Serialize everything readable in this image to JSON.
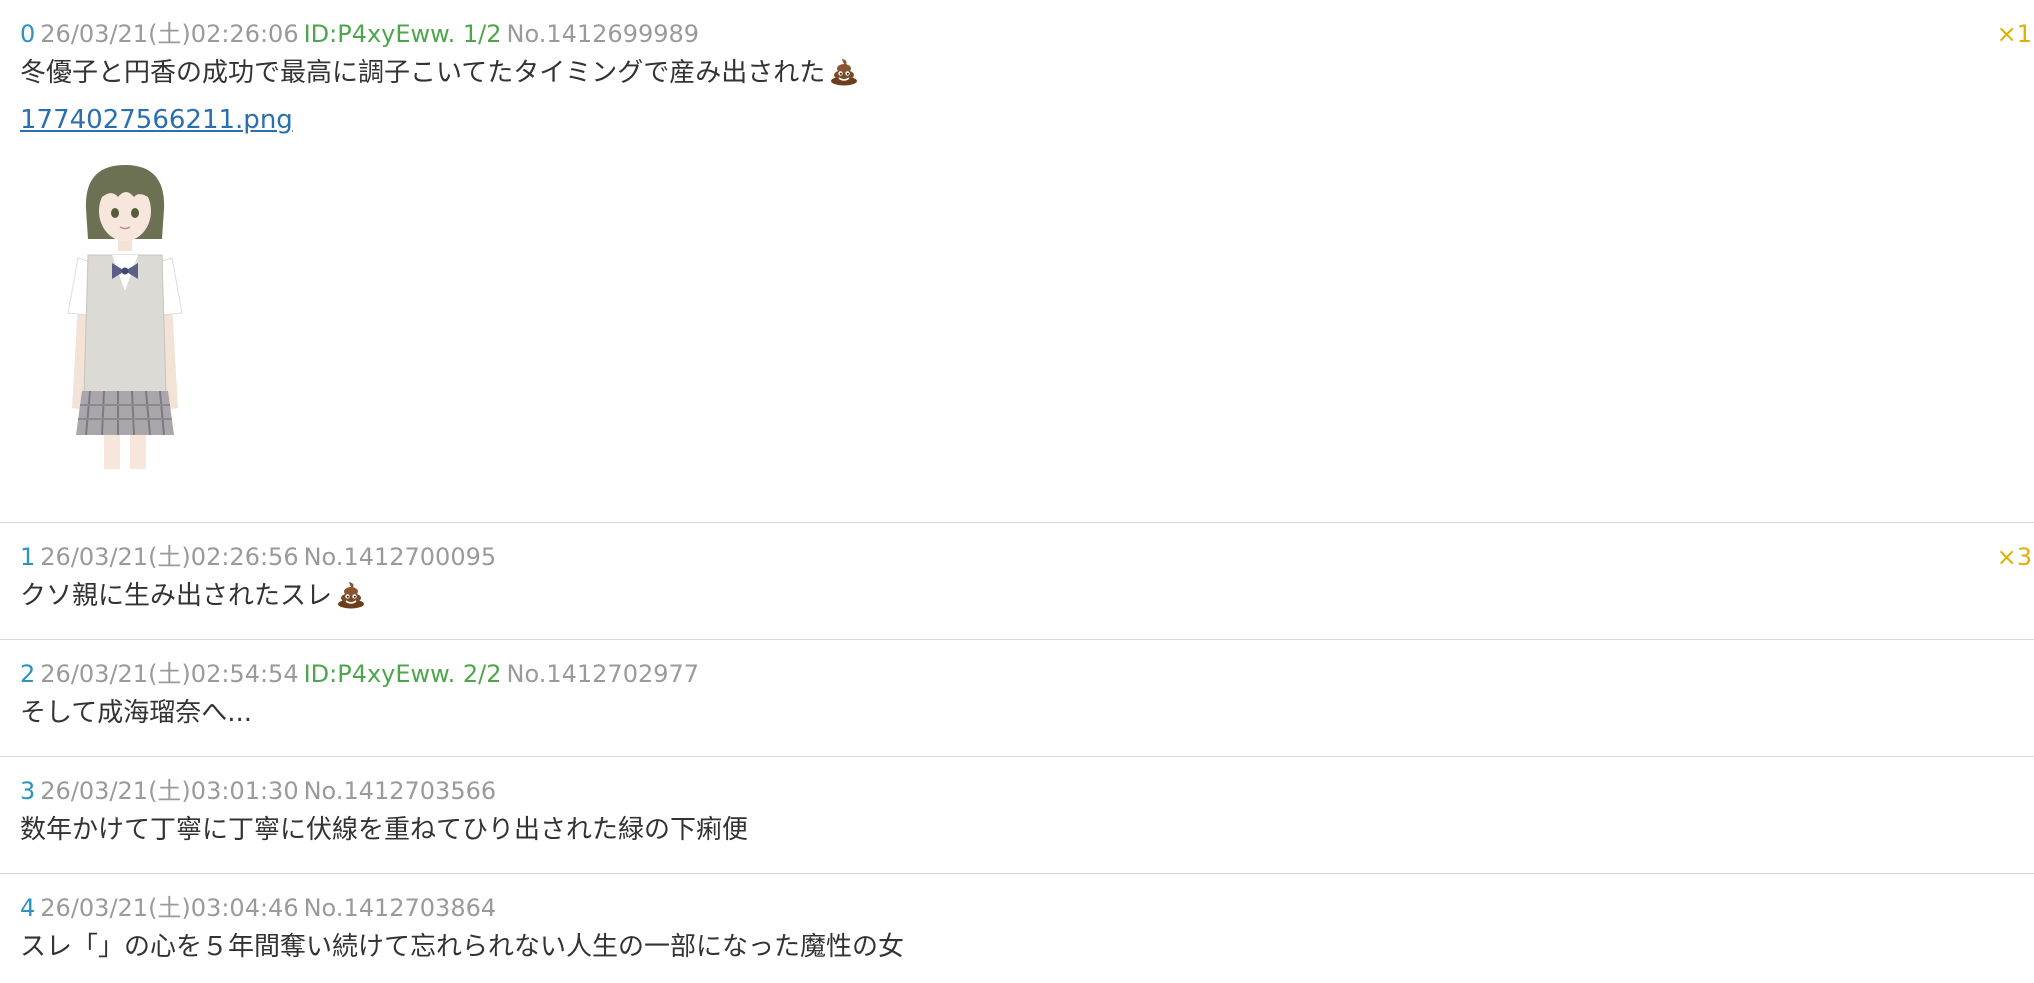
{
  "colors": {
    "post_number": "#2b93c2",
    "meta_gray": "#9a9a9a",
    "id_green": "#4ca64c",
    "reply_badge": "#e0b000",
    "link_blue": "#2a6fae",
    "body_text": "#333333",
    "divider": "#d9d9d9"
  },
  "posts": [
    {
      "number": "0",
      "datetime": "26/03/21(土)02:26:06",
      "id": "ID:P4xyEww. 1/2",
      "post_no": "No.1412699989",
      "reply_count": "×1",
      "text": "冬優子と円香の成功で最高に調子こいてたタイミングで産み出された",
      "emoji": "pile-of-poo-icon",
      "file_name": "1774027566211.png",
      "thumbnail": "girl-in-school-uniform-illustration"
    },
    {
      "number": "1",
      "datetime": "26/03/21(土)02:26:56",
      "post_no": "No.1412700095",
      "reply_count": "×3",
      "text": "クソ親に生み出されたスレ",
      "emoji": "pile-of-poo-icon"
    },
    {
      "number": "2",
      "datetime": "26/03/21(土)02:54:54",
      "id": "ID:P4xyEww. 2/2",
      "post_no": "No.1412702977",
      "text": "そして成海瑠奈へ..."
    },
    {
      "number": "3",
      "datetime": "26/03/21(土)03:01:30",
      "post_no": "No.1412703566",
      "text": "数年かけて丁寧に丁寧に伏線を重ねてひり出された緑の下痢便"
    },
    {
      "number": "4",
      "datetime": "26/03/21(土)03:04:46",
      "post_no": "No.1412703864",
      "text": "スレ「」の心を５年間奪い続けて忘れられない人生の一部になった魔性の女"
    }
  ]
}
